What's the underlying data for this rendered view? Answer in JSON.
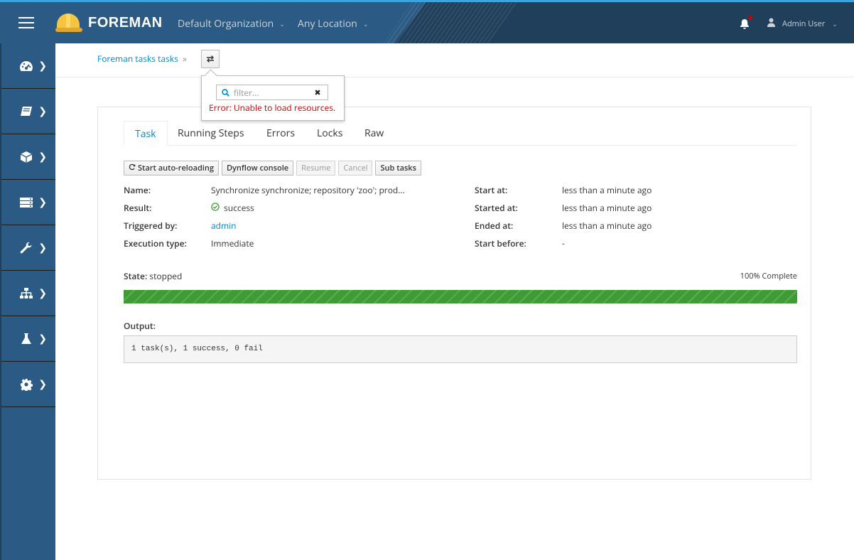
{
  "header": {
    "brand": "FOREMAN",
    "organization": "Default Organization",
    "location": "Any Location",
    "user": "Admin User",
    "notification_color": "#cc0000"
  },
  "sidebar": {
    "items": [
      {
        "icon": "dashboard-icon"
      },
      {
        "icon": "book-icon"
      },
      {
        "icon": "cube-icon"
      },
      {
        "icon": "server-icon"
      },
      {
        "icon": "wrench-icon"
      },
      {
        "icon": "network-icon"
      },
      {
        "icon": "flask-icon"
      },
      {
        "icon": "gear-icon"
      }
    ]
  },
  "breadcrumb": {
    "item": "Foreman tasks tasks",
    "separator": "»"
  },
  "switcher_popover": {
    "placeholder": "filter...",
    "error": "Error: Unable to load resources."
  },
  "tabs": [
    "Task",
    "Running Steps",
    "Errors",
    "Locks",
    "Raw"
  ],
  "actions": {
    "auto_reload": "Start auto-reloading",
    "dynflow": "Dynflow console",
    "resume": "Resume",
    "cancel": "Cancel",
    "sub_tasks": "Sub tasks"
  },
  "details_left": {
    "name_label": "Name:",
    "name_value": "Synchronize synchronize; repository 'zoo'; prod...",
    "result_label": "Result:",
    "result_value": "success",
    "triggered_label": "Triggered by:",
    "triggered_value": "admin",
    "exec_label": "Execution type:",
    "exec_value": "Immediate"
  },
  "details_right": {
    "start_at_label": "Start at:",
    "start_at_value": "less than a minute ago",
    "started_at_label": "Started at:",
    "started_at_value": "less than a minute ago",
    "ended_at_label": "Ended at:",
    "ended_at_value": "less than a minute ago",
    "start_before_label": "Start before:",
    "start_before_value": "-"
  },
  "state": {
    "label": "State:",
    "value": "stopped",
    "progress_text": "100% Complete",
    "progress_fraction": 1.0,
    "progress_color": "#3f9c35"
  },
  "output": {
    "label": "Output:",
    "text": "1 task(s), 1 success, 0 fail"
  }
}
